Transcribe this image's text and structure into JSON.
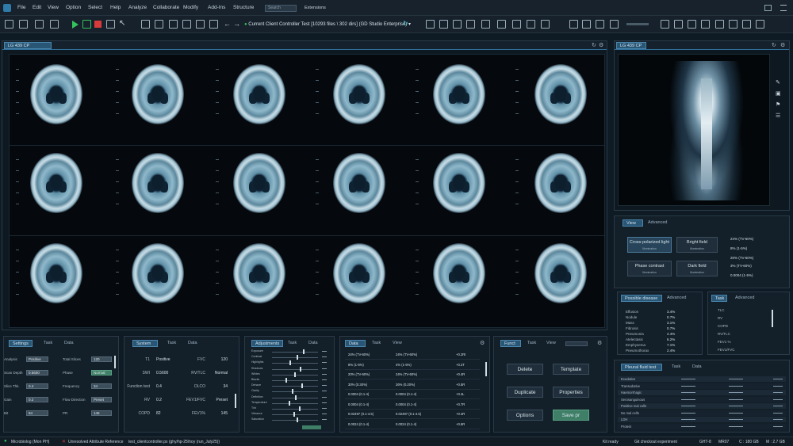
{
  "menu": {
    "items": [
      "File",
      "Edit",
      "View",
      "Option",
      "Select",
      "Help",
      "Analyze",
      "Collaborate",
      "Modify",
      "Add-Ins",
      "Structure"
    ],
    "search_placeholder": "Search",
    "extensions": "Extensions"
  },
  "toolbar": {
    "project": "Current Client Controller Test [10293 files \\ 302 dirs] (GD Studio Enterprise)"
  },
  "viewer": {
    "tab": "LG 439 CP"
  },
  "side_viewer": {
    "tab": "LG 439 CP"
  },
  "view_panel": {
    "tabs": [
      "View",
      "Advanced"
    ],
    "buttons": [
      {
        "title": "Cross-polarized light",
        "sub": "Illumination"
      },
      {
        "title": "Bright field",
        "sub": "Illumination"
      },
      {
        "title": "Phase contrast",
        "sub": "Illumination"
      },
      {
        "title": "Dark field",
        "sub": "Illumination"
      }
    ],
    "values": [
      "24% (TV-60%)",
      "8% (1-5%)",
      "20% (TV-60%)",
      "3% (TV-60%)",
      "0.0004 (1-5%)"
    ]
  },
  "disease_panel": {
    "tabs": [
      "Possible disease",
      "Advanced"
    ],
    "items": [
      [
        "Effusion",
        "3.4%"
      ],
      [
        "Nodule",
        "0.7%"
      ],
      [
        "Mass",
        "3.1%"
      ],
      [
        "Fibrosis",
        "0.7%"
      ],
      [
        "Pneumonia",
        "4.4%"
      ],
      [
        "Atelectasis",
        "6.2%"
      ],
      [
        "Emphysema",
        "7.1%"
      ],
      [
        "Pneumothorax",
        "2.4%"
      ]
    ]
  },
  "task_panel": {
    "tabs": [
      "Task",
      "Advanced"
    ],
    "items": [
      "TLC",
      "RV",
      "COPD",
      "RV/TLC",
      "FEV1 %",
      "FEV1/FVC"
    ]
  },
  "pleural_panel": {
    "tabs": [
      "Pleural fluid test",
      "Task",
      "Data"
    ],
    "rows": [
      "Exudative",
      "Transudative",
      "Haemorrhagic",
      "Serosanguinous",
      "Positive mal cells",
      "No mal cells",
      "LDH",
      "Protein"
    ]
  },
  "settings_panel": {
    "tabs": [
      "Settings",
      "Task",
      "Data"
    ],
    "rows": [
      {
        "label": "Analysis",
        "field": "Positive"
      },
      {
        "label": "Scan Depth",
        "field": "0.5600"
      },
      {
        "label": "Slice Thk.",
        "field": "0.4"
      },
      {
        "label": "Gain",
        "field": "0.2"
      },
      {
        "label": "Bit",
        "field": "84"
      }
    ],
    "rows2": [
      {
        "label": "Total Slices",
        "field": "120"
      },
      {
        "label": "Phase",
        "field": "Normal"
      },
      {
        "label": "Frequency",
        "field": "34"
      },
      {
        "label": "Flow Direction",
        "field": "Preset"
      },
      {
        "label": "PR",
        "field": "145"
      }
    ]
  },
  "system_panel": {
    "tabs": [
      "System",
      "Task",
      "Data"
    ],
    "rows": [
      [
        "T1",
        "Positive",
        "FVC",
        "120"
      ],
      [
        "SWI",
        "0.5600",
        "RV/TLC",
        "Normal"
      ],
      [
        "Function test",
        "0.4",
        "DLCO",
        "34"
      ],
      [
        "RV",
        "0.2",
        "FEV1/FVC",
        "Preset"
      ],
      [
        "COPD",
        "82",
        "FEV1%",
        "145"
      ]
    ]
  },
  "adjust_panel": {
    "tabs": [
      "Adjustments",
      "Task",
      "Data"
    ],
    "sliders": [
      {
        "name": "Exposure",
        "v": 0.7
      },
      {
        "name": "Contrast",
        "v": 0.55
      },
      {
        "name": "Highlights",
        "v": 0.4
      },
      {
        "name": "Shadows",
        "v": 0.62
      },
      {
        "name": "Whites",
        "v": 0.5
      },
      {
        "name": "Blacks",
        "v": 0.3
      },
      {
        "name": "Dehaze",
        "v": 0.66
      },
      {
        "name": "Clarity",
        "v": 0.45
      },
      {
        "name": "Definition",
        "v": 0.52
      },
      {
        "name": "Temperature",
        "v": 0.38
      },
      {
        "name": "Tint",
        "v": 0.6
      },
      {
        "name": "Vibrance",
        "v": 0.48
      },
      {
        "name": "Saturation",
        "v": 0.56
      }
    ]
  },
  "data_panel": {
    "tabs": [
      "Data",
      "Task",
      "View"
    ],
    "rows": [
      [
        "24% (TV-60%)",
        "24% (TV-60%)",
        "+0.2RI"
      ],
      [
        "8% (1-5%)",
        "4% (1-5%)",
        "+0.2T"
      ],
      [
        "20% (TV-60%)",
        "24% (TV-60%)",
        "+0.4R"
      ],
      [
        "30% (0.30%)",
        "26% (0.20%)",
        "+0.5R"
      ],
      [
        "0.0004 (0.1-4)",
        "0.0004 (0.1-4)",
        "+0.4L"
      ],
      [
        "0.0004 (0.1-4)",
        "0.0004 (0.1-4)",
        "+0.7R"
      ],
      [
        "0.02497 (0.1-4.5)",
        "0.02497 (0.1-4.5)",
        "+0.4R"
      ],
      [
        "0.0024 (0.1-4)",
        "0.0024 (0.1-4)",
        "+0.6R"
      ]
    ]
  },
  "function_panel": {
    "tabs": [
      "Funct",
      "Task",
      "View"
    ],
    "buttons": [
      "Delete",
      "Template",
      "Duplicate",
      "Properties",
      "Options",
      "Save pr"
    ]
  },
  "status": {
    "left": [
      "Microbiolog (Mon PH)",
      "Unresolved Attribute Reference",
      "test_clientcontroller.px (ghy/hp-25\\hoy (run_July25))"
    ],
    "right": [
      "Kit ready",
      "Git checkout experiment",
      "GHT-8",
      "MR07",
      "C : 180 GB",
      "M : 2.7 GB"
    ]
  },
  "colors": {
    "accent": "#2b6b92",
    "save": "#3f7f67"
  }
}
